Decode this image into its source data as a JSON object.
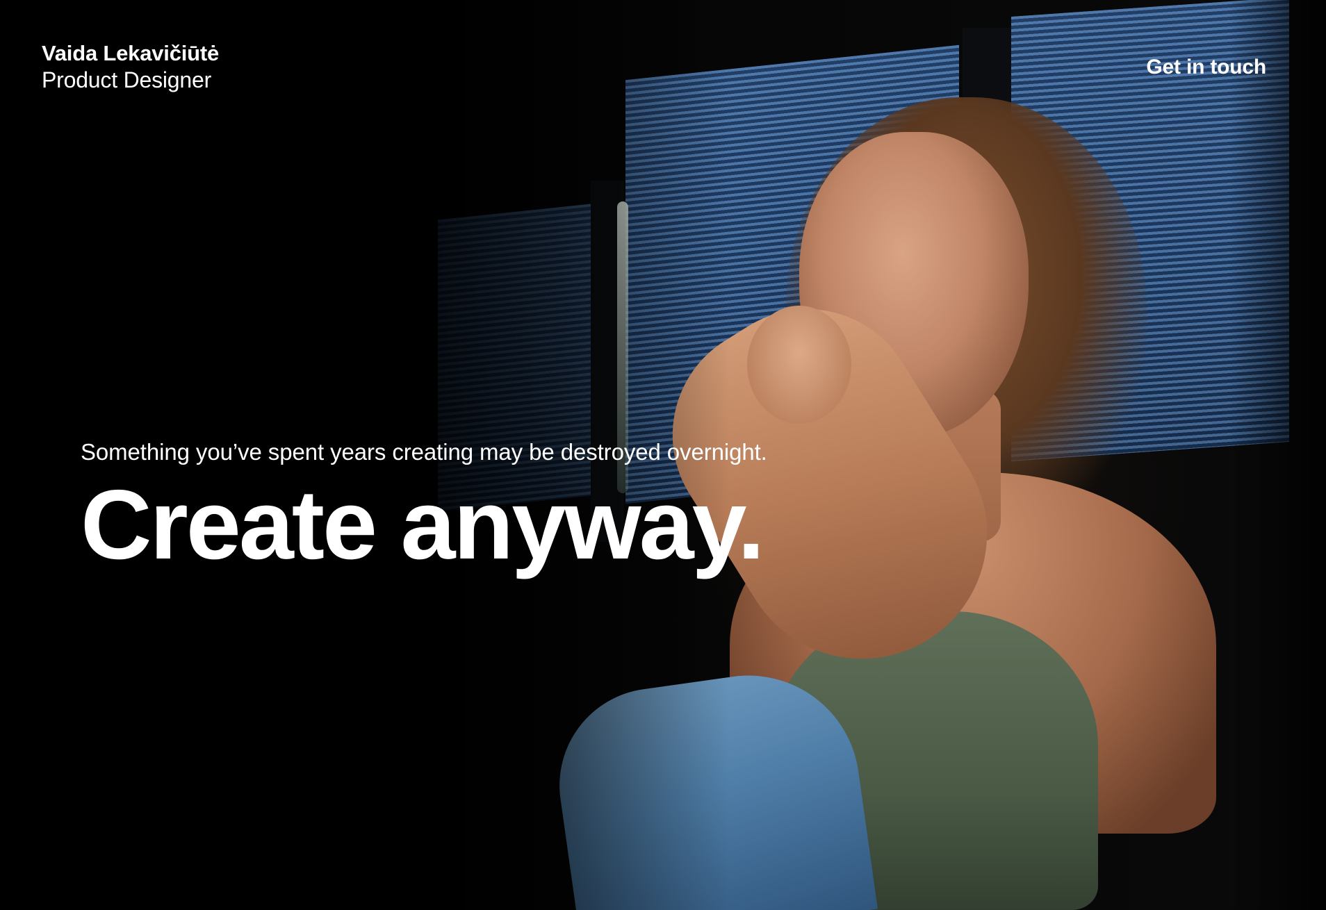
{
  "header": {
    "brand_name": "Vaida Lekavičiūtė",
    "brand_role": "Product Designer",
    "contact_label": "Get in touch"
  },
  "hero": {
    "subtitle": "Something you’ve spent years creating may be destroyed overnight.",
    "title": "Create anyway."
  },
  "colors": {
    "background": "#000000",
    "text": "#ffffff"
  }
}
